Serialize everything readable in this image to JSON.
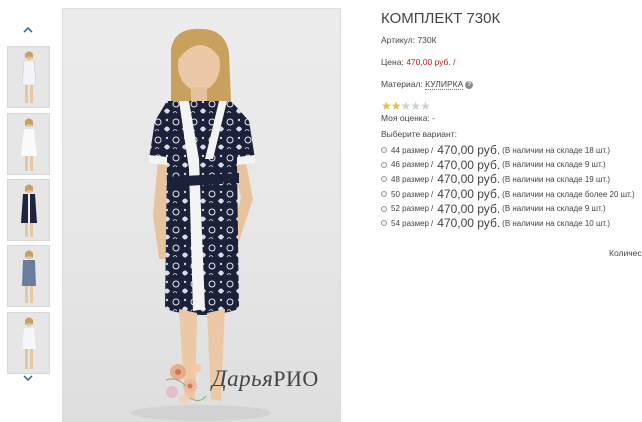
{
  "gallery": {
    "up_icon": "chevron-up-icon",
    "down_icon": "chevron-down-icon",
    "thumbnails": [
      {
        "icon": "model-white-dress"
      },
      {
        "icon": "model-white-slip"
      },
      {
        "icon": "model-dark-robe"
      },
      {
        "icon": "model-blue-robe"
      },
      {
        "icon": "model-white-set"
      }
    ]
  },
  "watermark": {
    "script": "Дарья",
    "brand": "РИО"
  },
  "product": {
    "title": "КОМПЛЕКТ 730К",
    "sku_label": "Артикул:",
    "sku": "730К",
    "price_label": "Цена:",
    "price": "470,00 руб.",
    "price_sep": "/",
    "material_label": "Материал:",
    "material": "КУЛИРКА",
    "rating": 2,
    "rating_max": 5,
    "my_rating_label": "Моя оценка: -",
    "choose_label": "Выберите вариант:",
    "variants": [
      {
        "size": "44 размер",
        "sep": "/",
        "price": "470,00 руб.",
        "stock": "(В наличии на складе 18 шт.)"
      },
      {
        "size": "46 размер",
        "sep": "/",
        "price": "470,00 руб.",
        "stock": "(В наличии на складе 9 шт.)"
      },
      {
        "size": "48 размер",
        "sep": "/",
        "price": "470,00 руб.",
        "stock": "(В наличии на складе 19 шт.)"
      },
      {
        "size": "50 размер",
        "sep": "/",
        "price": "470,00 руб.",
        "stock": "(В наличии на складе более 20 шт.)"
      },
      {
        "size": "52 размер",
        "sep": "/",
        "price": "470,00 руб.",
        "stock": "(В наличии на складе 9 шт.)"
      },
      {
        "size": "54 размер",
        "sep": "/",
        "price": "470,00 руб.",
        "stock": "(В наличии на складе 10 шт.)"
      }
    ],
    "quantity_label": "Количес"
  },
  "colors": {
    "price": "#c41a1a",
    "star_filled": "#e0c04a",
    "star_empty": "#d0d0d0",
    "robe_dark": "#1b2138"
  }
}
